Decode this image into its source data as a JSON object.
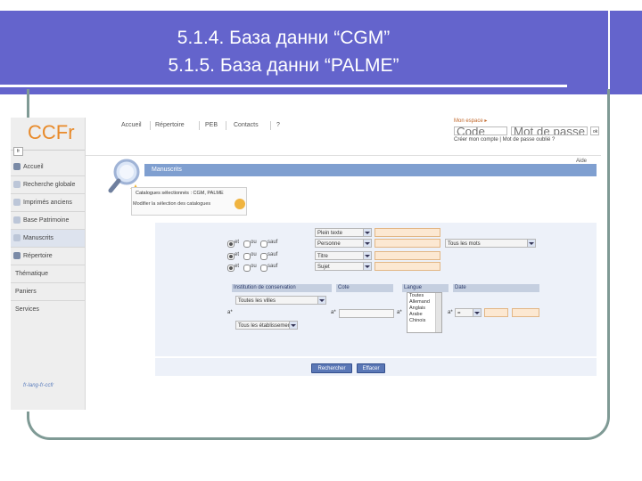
{
  "slide": {
    "title_line1": "5.1.4. База данни “CGM”",
    "title_line2": "5.1.5. База данни “PALME”"
  },
  "colors": {
    "title_band": "#6464cc",
    "frame": "#7f9a95",
    "header_bar": "#7f9fd0",
    "logo": "#e88a2a",
    "button": "#5a77b6"
  },
  "screenshot": {
    "logo": "CCFr",
    "lang_badge": "fr",
    "sidebar": {
      "items": [
        {
          "label": "Accueil",
          "icon": "house-icon"
        },
        {
          "label": "Recherche globale",
          "icon": "magnifier-icon"
        },
        {
          "label": "Imprimés anciens",
          "icon": "magnifier-icon"
        },
        {
          "label": "Base Patrimoine",
          "icon": "magnifier-icon"
        },
        {
          "label": "Manuscrits",
          "icon": "magnifier-icon"
        },
        {
          "label": "Répertoire",
          "icon": "book-icon"
        },
        {
          "label": "Thématique",
          "icon": ""
        },
        {
          "label": "Paniers",
          "icon": ""
        },
        {
          "label": "Services",
          "icon": ""
        }
      ],
      "footer": "fr-lang-fr-ccfr"
    },
    "topnav": {
      "links": [
        "Accueil",
        "Répertoire",
        "PEB",
        "Contacts",
        "?"
      ]
    },
    "login": {
      "title": "Mon espace ▸",
      "code_placeholder": "Code",
      "password_placeholder": "Mot de passe",
      "ok": "ok",
      "row2": "Créer mon compte | Mot de passe oublié ?"
    },
    "aide": "Aide",
    "header_title": "Manuscrits",
    "catalogue_panel": {
      "line1": "Catalogues sélectionnés : CGM, PALME",
      "line2": "Modifier la sélection des catalogues"
    },
    "criteria": {
      "rows": [
        {
          "radio": [
            "et",
            "ou",
            "sauf"
          ],
          "selected": 0,
          "field": "Plein texte"
        },
        {
          "radio": [
            "et",
            "ou",
            "sauf"
          ],
          "selected": 0,
          "field": "Personne"
        },
        {
          "radio": [
            "et",
            "ou",
            "sauf"
          ],
          "selected": 0,
          "field": "Titre"
        },
        {
          "radio": [
            "et",
            "ou",
            "sauf"
          ],
          "selected": 0,
          "field": "Sujet"
        }
      ],
      "extra_select": "Tous les mots"
    },
    "filters": {
      "institution_header": "Institution de conservation",
      "cote_header": "Cote",
      "langue_header": "Langue",
      "date_header": "Date",
      "institution_select": "Toutes les villes",
      "fonds_select": "Tous les établissements",
      "prefix_label": "a*",
      "langue_options": [
        "Toutes",
        "Allemand",
        "Anglais",
        "Arabe",
        "Chinois"
      ],
      "date_select": "="
    },
    "buttons": {
      "search": "Rechercher",
      "reset": "Effacer"
    }
  }
}
